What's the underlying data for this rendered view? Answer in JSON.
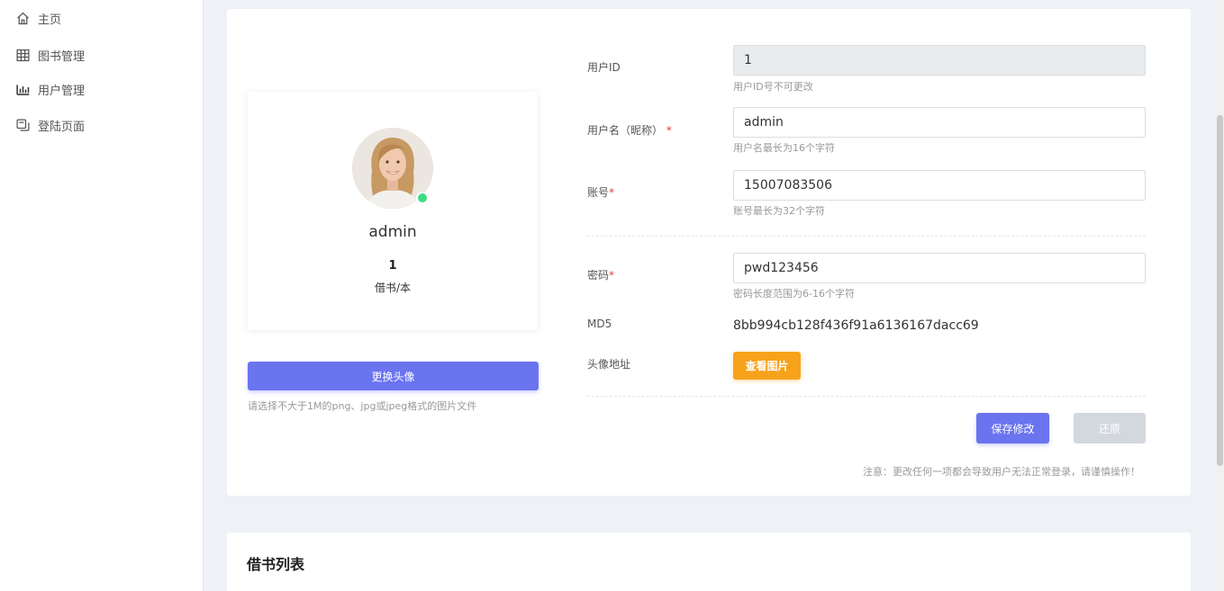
{
  "sidebar": {
    "items": [
      {
        "label": "主页",
        "icon": "home-icon"
      },
      {
        "label": "图书管理",
        "icon": "table-icon"
      },
      {
        "label": "用户管理",
        "icon": "bar-chart-icon"
      },
      {
        "label": "登陆页面",
        "icon": "copy-icon"
      }
    ]
  },
  "profile": {
    "name": "admin",
    "count": "1",
    "unit": "借书/本",
    "status_color": "#3ddc84",
    "change_avatar_label": "更换头像",
    "avatar_hint": "请选择不大于1M的png、jpg或jpeg格式的图片文件"
  },
  "form": {
    "user_id": {
      "label": "用户ID",
      "value": "1",
      "hint": "用户ID号不可更改"
    },
    "username": {
      "label": "用户名（昵称）",
      "required": "*",
      "value": "admin",
      "hint": "用户名最长为16个字符"
    },
    "account": {
      "label": "账号",
      "required": "*",
      "value": "15007083506",
      "hint": "账号最长为32个字符"
    },
    "password": {
      "label": "密码",
      "required": "*",
      "value": "pwd123456",
      "hint": "密码长度范围为6-16个字符"
    },
    "md5": {
      "label": "MD5",
      "value": "8bb994cb128f436f91a6136167dacc69"
    },
    "avatar_url": {
      "label": "头像地址",
      "button": "查看图片"
    }
  },
  "actions": {
    "save_label": "保存修改",
    "reset_label": "还原",
    "notice": "注意：更改任何一项都会导致用户无法正常登录，请谨慎操作！"
  },
  "borrow_list": {
    "title": "借书列表"
  },
  "colors": {
    "primary": "#6a74ef",
    "warning": "#f7a21b",
    "required": "#e53935"
  }
}
